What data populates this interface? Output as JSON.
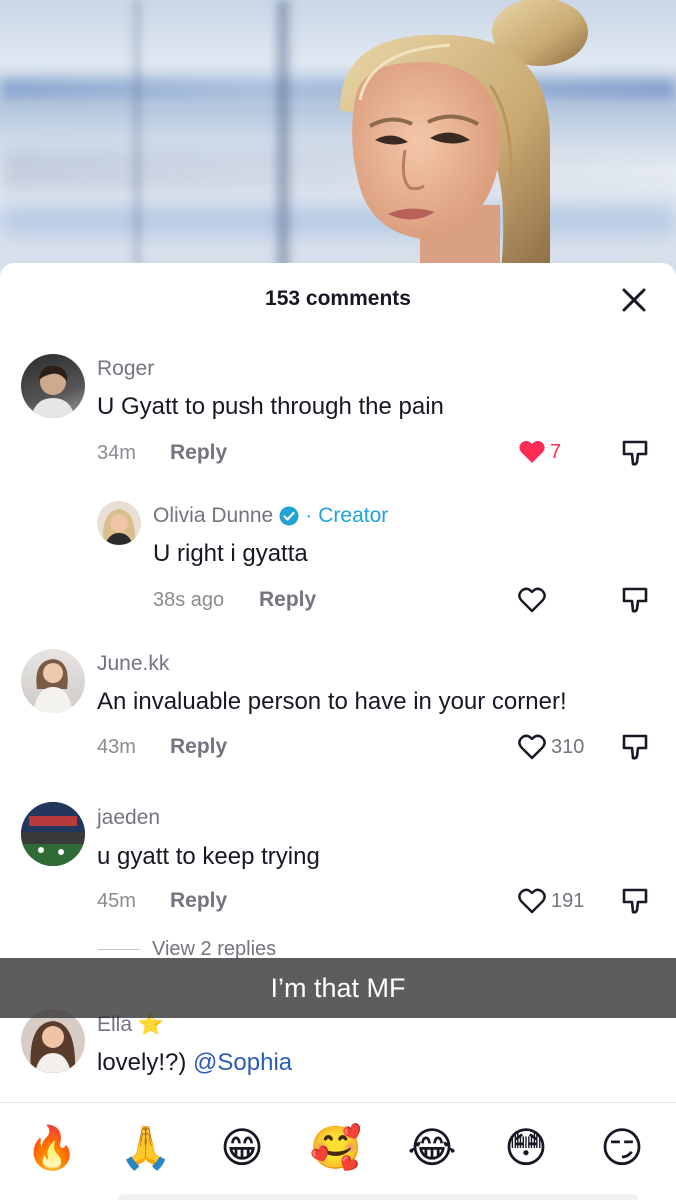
{
  "header": {
    "comment_count": "153 comments"
  },
  "caption": {
    "text": "I’m that MF"
  },
  "comments": [
    {
      "username": "Roger",
      "text": "U Gyatt to push through the pain",
      "time": "34m",
      "reply_label": "Reply",
      "likes": "7",
      "liked": true
    },
    {
      "username": "Olivia Dunne",
      "badge_label": "Creator",
      "text": "U right i gyatta",
      "time": "38s ago",
      "reply_label": "Reply",
      "likes": ""
    },
    {
      "username": "June.kk",
      "text": "An invaluable person to have in your corner!",
      "time": "43m",
      "reply_label": "Reply",
      "likes": "310"
    },
    {
      "username": "jaeden",
      "text": "u gyatt to keep trying",
      "time": "45m",
      "reply_label": "Reply",
      "likes": "191",
      "view_replies": "View 2 replies"
    },
    {
      "username": "Ella ⭐",
      "text": "lovely!?)",
      "mention": "@Sophia"
    }
  ],
  "emojis": [
    "🔥",
    "🙏",
    "😁",
    "🥰",
    "😂",
    "😳",
    "😏"
  ],
  "colors": {
    "like_red": "#fe2c55",
    "creator_blue": "#20a4d8",
    "mention_blue": "#2b5db8",
    "muted_text": "#737480"
  }
}
